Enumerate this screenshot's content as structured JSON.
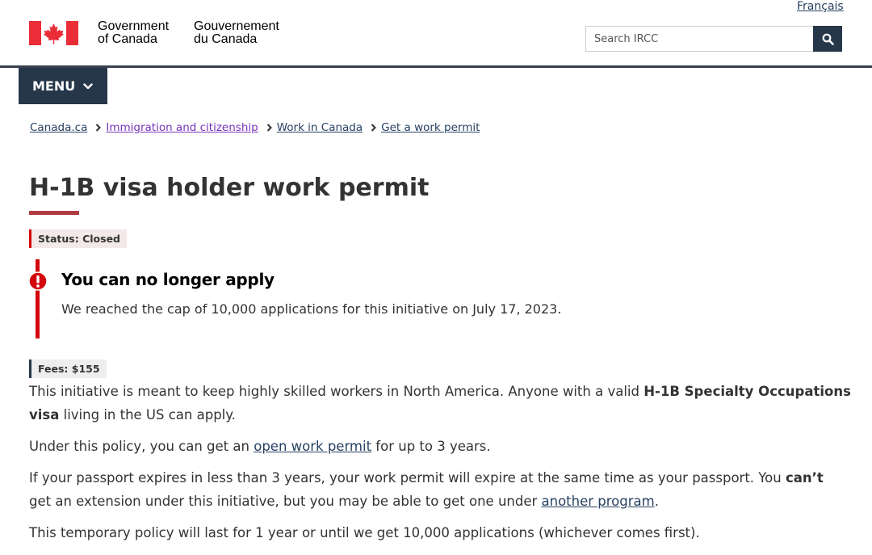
{
  "header": {
    "language_link": "Français",
    "signature": {
      "en_line1": "Government",
      "en_line2": "of Canada",
      "fr_line1": "Gouvernement",
      "fr_line2": "du Canada"
    },
    "search": {
      "placeholder": "Search IRCC",
      "button_icon": "search-icon"
    },
    "menu_label": "MENU"
  },
  "breadcrumb": [
    {
      "label": "Canada.ca"
    },
    {
      "label": "Immigration and citizenship"
    },
    {
      "label": "Work in Canada"
    },
    {
      "label": "Get a work permit"
    }
  ],
  "main": {
    "title": "H-1B visa holder work permit",
    "status": "Status: Closed",
    "alert": {
      "icon": "exclamation-circle-icon",
      "heading": "You can no longer apply",
      "text": "We reached the cap of 10,000 applications for this initiative on July 17, 2023."
    },
    "fees": "Fees: $155",
    "paragraphs": {
      "p1_a": "This initiative is meant to keep highly skilled workers in North America. Anyone with a valid ",
      "p1_bold": "H-1B Specialty Occupations",
      "p1_line2_bold": "visa",
      "p1_line2_rest": " living in the US can apply.",
      "p2_a": "Under this policy, you can get an ",
      "p2_link": "open work permit",
      "p2_b": " for up to 3 years.",
      "p3_a": "If your passport expires in less than 3 years, your work permit will expire at the same time as your passport. You ",
      "p3_bold": "can’t",
      "p3_line2_a": "get an extension under this initiative, but you may be able to get one under ",
      "p3_link": "another program",
      "p3_line2_b": ".",
      "p4": "This temporary policy will last for 1 year or until we get 10,000 applications (whichever comes first)."
    }
  },
  "colors": {
    "flag_red": "#eb2d37",
    "header_dark": "#26374a",
    "link": "#284162",
    "visited_link": "#7834bc",
    "title_accent": "#af3c43",
    "danger": "#d3080c"
  }
}
